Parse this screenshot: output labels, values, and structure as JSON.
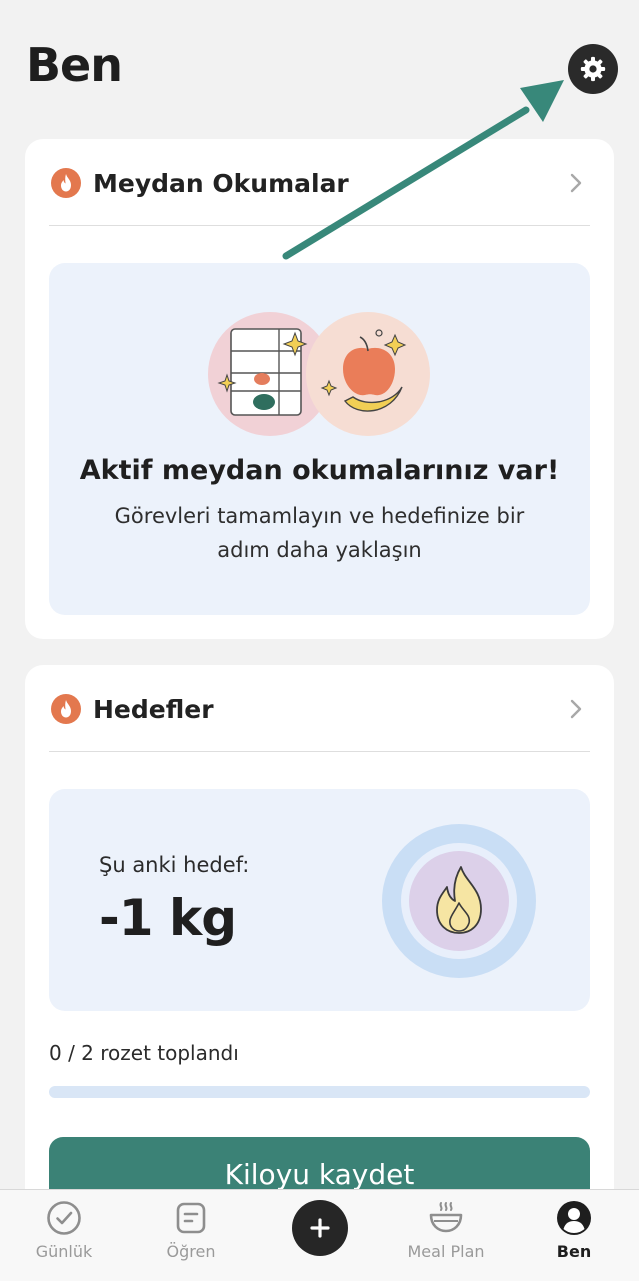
{
  "header": {
    "title": "Ben",
    "settings_icon": "gear-icon"
  },
  "challenges": {
    "title": "Meydan Okumalar",
    "icon": "flame-icon",
    "heading": "Aktif meydan okumalarınız var!",
    "subtitle": "Görevleri tamamlayın ve hedefinize bir adım daha yaklaşın"
  },
  "goals": {
    "title": "Hedefler",
    "icon": "flame-icon",
    "current_label": "Şu anki hedef:",
    "current_value": "-1 kg",
    "badges_text": "0 / 2 rozet toplandı",
    "badges_progress": 0,
    "button_label": "Kiloyu kaydet"
  },
  "nav": {
    "items": [
      {
        "label": "Günlük",
        "icon": "check-circle-icon"
      },
      {
        "label": "Öğren",
        "icon": "document-icon"
      },
      {
        "label": "",
        "icon": "plus-icon"
      },
      {
        "label": "Meal Plan",
        "icon": "bowl-icon"
      },
      {
        "label": "Ben",
        "icon": "profile-icon"
      }
    ]
  },
  "colors": {
    "accent": "#3b8276",
    "flame": "#e3784e",
    "panel": "#ecf2fb",
    "background": "#f2f2f2"
  }
}
